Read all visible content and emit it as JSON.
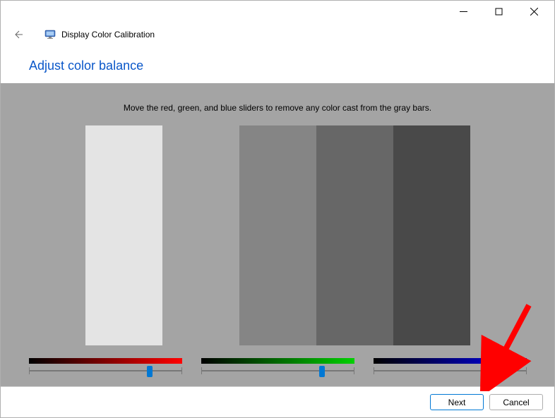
{
  "window": {
    "title": "Display Color Calibration"
  },
  "heading": "Adjust color balance",
  "instruction": "Move the red, green, and blue sliders to remove any color cast from the gray bars.",
  "grayBars": {
    "colors": [
      "#e4e4e4",
      "#a4a4a4",
      "#858585",
      "#676767",
      "#494949"
    ]
  },
  "sliders": {
    "red": {
      "value": 79
    },
    "green": {
      "value": 79
    },
    "blue": {
      "value": 79
    }
  },
  "footer": {
    "next": "Next",
    "cancel": "Cancel"
  }
}
